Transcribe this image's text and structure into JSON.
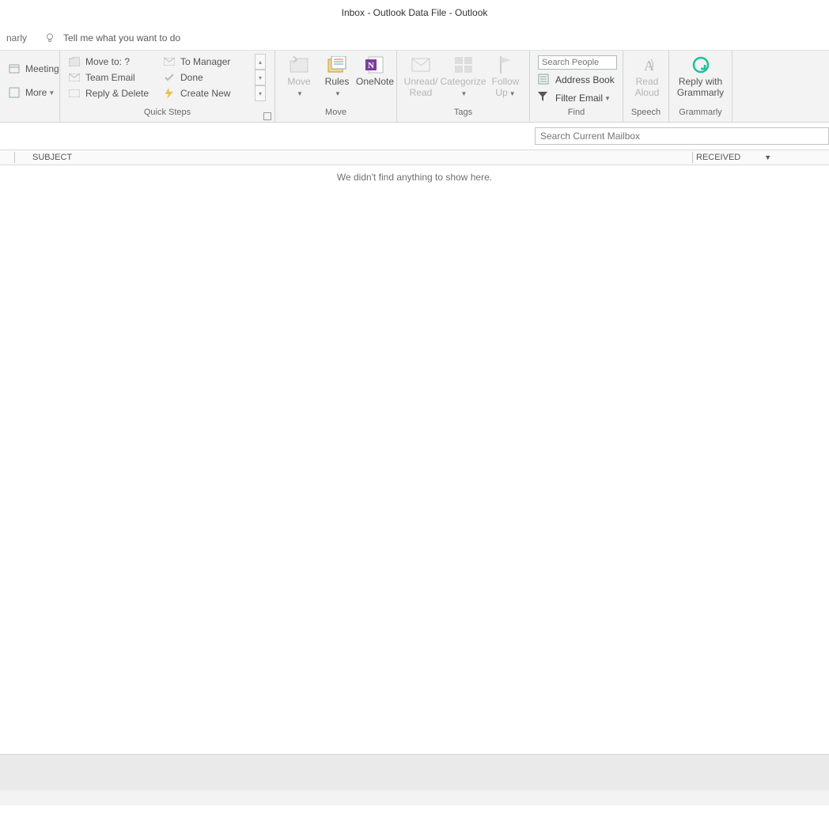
{
  "title": "Inbox - Outlook Data File  -  Outlook",
  "tellme": {
    "partial": "narly",
    "placeholder": "Tell me what you want to do"
  },
  "leftpartial": {
    "meeting": "Meeting",
    "more": "More"
  },
  "quicksteps": {
    "label": "Quick Steps",
    "items": [
      "Move to: ?",
      "To Manager",
      "Team Email",
      "Done",
      "Reply & Delete",
      "Create New"
    ]
  },
  "move": {
    "label": "Move",
    "move": "Move",
    "rules": "Rules",
    "onenote": "OneNote"
  },
  "tags": {
    "label": "Tags",
    "unread1": "Unread/",
    "unread2": "Read",
    "categorize": "Categorize",
    "follow1": "Follow",
    "follow2": "Up"
  },
  "find": {
    "label": "Find",
    "search_ph": "Search People",
    "address": "Address Book",
    "filter": "Filter Email"
  },
  "speech": {
    "label": "Speech",
    "read1": "Read",
    "read2": "Aloud"
  },
  "grammarly": {
    "label": "Grammarly",
    "reply1": "Reply with",
    "reply2": "Grammarly"
  },
  "search_mailbox_ph": "Search Current Mailbox",
  "columns": {
    "subject": "SUBJECT",
    "received": "RECEIVED"
  },
  "empty": "We didn't find anything to show here."
}
